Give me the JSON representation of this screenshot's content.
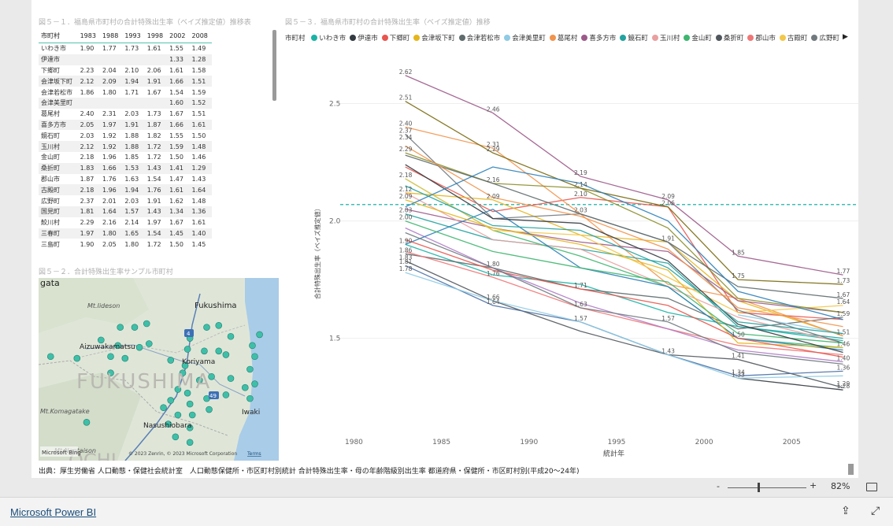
{
  "titles": {
    "table": "図５－１．福島県市町村の合計特殊出生率（ベイズ推定値）推移表",
    "map": "図５－２．合計特殊出生率サンプル市町村",
    "chart": "図５－３．福島県市町村の合計特殊出生率（ベイズ推定値）推移"
  },
  "table": {
    "headers": [
      "市町村",
      "1983",
      "1988",
      "1993",
      "1998",
      "2002",
      "2008"
    ],
    "rows": [
      [
        "いわき市",
        "1.90",
        "1.77",
        "1.73",
        "1.61",
        "1.55",
        "1.49"
      ],
      [
        "伊達市",
        "",
        "",
        "",
        "",
        "1.33",
        "1.28"
      ],
      [
        "下郷町",
        "2.23",
        "2.04",
        "2.10",
        "2.06",
        "1.61",
        "1.58"
      ],
      [
        "会津坂下町",
        "2.12",
        "2.09",
        "1.94",
        "1.91",
        "1.66",
        "1.51"
      ],
      [
        "会津若松市",
        "1.86",
        "1.80",
        "1.71",
        "1.67",
        "1.54",
        "1.59"
      ],
      [
        "会津美里町",
        "",
        "",
        "",
        "",
        "1.60",
        "1.52"
      ],
      [
        "葛尾村",
        "2.40",
        "2.31",
        "2.03",
        "1.73",
        "1.67",
        "1.51"
      ],
      [
        "喜多方市",
        "2.05",
        "1.97",
        "1.91",
        "1.87",
        "1.66",
        "1.61"
      ],
      [
        "鏡石町",
        "2.03",
        "1.92",
        "1.88",
        "1.82",
        "1.55",
        "1.50"
      ],
      [
        "玉川村",
        "2.12",
        "1.92",
        "1.88",
        "1.72",
        "1.59",
        "1.48"
      ],
      [
        "金山町",
        "2.18",
        "1.96",
        "1.85",
        "1.72",
        "1.50",
        "1.46"
      ],
      [
        "桑折町",
        "1.83",
        "1.66",
        "1.53",
        "1.43",
        "1.41",
        "1.29"
      ],
      [
        "郡山市",
        "1.87",
        "1.76",
        "1.63",
        "1.54",
        "1.47",
        "1.43"
      ],
      [
        "古殿町",
        "2.18",
        "1.96",
        "1.94",
        "1.76",
        "1.61",
        "1.64"
      ],
      [
        "広野町",
        "2.37",
        "2.01",
        "2.03",
        "1.91",
        "1.62",
        "1.48"
      ],
      [
        "国見町",
        "1.81",
        "1.64",
        "1.57",
        "1.43",
        "1.34",
        "1.36"
      ],
      [
        "鮫川村",
        "2.29",
        "2.16",
        "2.14",
        "1.97",
        "1.67",
        "1.61"
      ],
      [
        "三春町",
        "1.97",
        "1.80",
        "1.65",
        "1.54",
        "1.45",
        "1.40"
      ],
      [
        "三島町",
        "1.90",
        "2.05",
        "1.80",
        "1.72",
        "1.50",
        "1.45"
      ]
    ]
  },
  "map": {
    "labels": {
      "gata": "gata",
      "iideson": "Mt.Iideson",
      "fukushima_city": "Fukushima",
      "aizu": "Aizuwakamatsu",
      "koriyama": "Koriyama",
      "pref": "FUKUSHIMA",
      "komagatake": "Mt.Komagatake",
      "nasu": "Nasushiobara",
      "iwaki": "Iwaki",
      "nantaisan": "Mt.Nantaison",
      "ochi": "OCHI",
      "road1": "4",
      "road2": "49",
      "brand": "Microsoft Bing",
      "copyright": "© 2023 Zenrin, © 2023 Microsoft Corporation",
      "terms": "Terms"
    },
    "pin_color": "#3fbfa8",
    "pins": [
      [
        0.34,
        0.27
      ],
      [
        0.4,
        0.27
      ],
      [
        0.45,
        0.25
      ],
      [
        0.63,
        0.33
      ],
      [
        0.7,
        0.27
      ],
      [
        0.75,
        0.26
      ],
      [
        0.8,
        0.32
      ],
      [
        0.26,
        0.34
      ],
      [
        0.33,
        0.37
      ],
      [
        0.42,
        0.38
      ],
      [
        0.46,
        0.36
      ],
      [
        0.62,
        0.39
      ],
      [
        0.69,
        0.4
      ],
      [
        0.75,
        0.4
      ],
      [
        0.89,
        0.37
      ],
      [
        0.92,
        0.31
      ],
      [
        0.16,
        0.44
      ],
      [
        0.3,
        0.43
      ],
      [
        0.36,
        0.44
      ],
      [
        0.55,
        0.45
      ],
      [
        0.61,
        0.48
      ],
      [
        0.78,
        0.42
      ],
      [
        0.9,
        0.43
      ],
      [
        0.6,
        0.52
      ],
      [
        0.67,
        0.56
      ],
      [
        0.72,
        0.54
      ],
      [
        0.8,
        0.55
      ],
      [
        0.88,
        0.5
      ],
      [
        0.9,
        0.58
      ],
      [
        0.58,
        0.61
      ],
      [
        0.62,
        0.63
      ],
      [
        0.7,
        0.66
      ],
      [
        0.78,
        0.64
      ],
      [
        0.88,
        0.66
      ],
      [
        0.86,
        0.6
      ],
      [
        0.55,
        0.67
      ],
      [
        0.63,
        0.69
      ],
      [
        0.58,
        0.75
      ],
      [
        0.64,
        0.75
      ],
      [
        0.54,
        0.8
      ],
      [
        0.63,
        0.82
      ],
      [
        0.57,
        0.87
      ],
      [
        0.63,
        0.9
      ],
      [
        0.05,
        0.43
      ],
      [
        0.3,
        0.52
      ],
      [
        0.2,
        0.79
      ],
      [
        0.52,
        0.71
      ],
      [
        0.71,
        0.72
      ]
    ]
  },
  "chart": {
    "legend_title": "市町村",
    "legend": [
      {
        "name": "いわき市",
        "color": "#1ab3a6"
      },
      {
        "name": "伊達市",
        "color": "#333a40"
      },
      {
        "name": "下郷町",
        "color": "#e8564f"
      },
      {
        "name": "会津坂下町",
        "color": "#e5b61c"
      },
      {
        "name": "会津若松市",
        "color": "#5f6b6d"
      },
      {
        "name": "会津美里町",
        "color": "#8fcbe4"
      },
      {
        "name": "葛尾村",
        "color": "#f2934d"
      },
      {
        "name": "喜多方市",
        "color": "#9c5a8a"
      },
      {
        "name": "鏡石町",
        "color": "#22a3a0"
      },
      {
        "name": "玉川村",
        "color": "#e9a0a0"
      },
      {
        "name": "金山町",
        "color": "#3fb670"
      },
      {
        "name": "桑折町",
        "color": "#50575c"
      },
      {
        "name": "郡山市",
        "color": "#f07777"
      },
      {
        "name": "古殿町",
        "color": "#f2c84b"
      },
      {
        "name": "広野町",
        "color": "#707a7f"
      }
    ],
    "next_icon": "▶"
  },
  "chart_data": {
    "type": "line",
    "xlabel": "統計年",
    "ylabel": "合計特殊出生率（ベイズ推定値）",
    "xlim": [
      1980,
      2010
    ],
    "ylim": [
      1.18,
      2.74
    ],
    "xticks": [
      "1980",
      "1985",
      "1990",
      "1995",
      "2000",
      "2005",
      "2010"
    ],
    "yticks": [
      "1.5",
      "2.0",
      "2.5"
    ],
    "reference_line": 2.07,
    "x": [
      1983,
      1988,
      1993,
      1998,
      2002,
      2008
    ],
    "series": [
      {
        "name": "いわき市",
        "color": "#1ab3a6",
        "values": [
          1.9,
          1.77,
          1.73,
          1.61,
          1.55,
          1.49
        ]
      },
      {
        "name": "伊達市",
        "color": "#333a40",
        "values": [
          null,
          null,
          null,
          null,
          1.33,
          1.28
        ]
      },
      {
        "name": "下郷町",
        "color": "#e8564f",
        "values": [
          2.23,
          2.04,
          2.1,
          2.06,
          1.61,
          1.58
        ]
      },
      {
        "name": "会津坂下町",
        "color": "#e5b61c",
        "values": [
          2.12,
          2.09,
          1.94,
          1.91,
          1.66,
          1.51
        ]
      },
      {
        "name": "会津若松市",
        "color": "#5f6b6d",
        "values": [
          1.86,
          1.8,
          1.71,
          1.67,
          1.54,
          1.59
        ]
      },
      {
        "name": "会津美里町",
        "color": "#8fcbe4",
        "values": [
          null,
          null,
          null,
          null,
          1.6,
          1.52
        ]
      },
      {
        "name": "葛尾村",
        "color": "#f2934d",
        "values": [
          2.4,
          2.31,
          2.03,
          1.73,
          1.67,
          1.51
        ]
      },
      {
        "name": "喜多方市",
        "color": "#9c5a8a",
        "values": [
          2.05,
          1.97,
          1.91,
          1.87,
          1.66,
          1.61
        ]
      },
      {
        "name": "鏡石町",
        "color": "#22a3a0",
        "values": [
          2.03,
          1.92,
          1.88,
          1.82,
          1.55,
          1.5
        ]
      },
      {
        "name": "玉川村",
        "color": "#e9a0a0",
        "values": [
          2.12,
          1.92,
          1.88,
          1.72,
          1.59,
          1.48
        ]
      },
      {
        "name": "金山町",
        "color": "#3fb670",
        "values": [
          2.18,
          1.96,
          1.85,
          1.72,
          1.5,
          1.46
        ]
      },
      {
        "name": "桑折町",
        "color": "#50575c",
        "values": [
          1.83,
          1.66,
          1.53,
          1.43,
          1.41,
          1.29
        ]
      },
      {
        "name": "郡山市",
        "color": "#f07777",
        "values": [
          1.87,
          1.76,
          1.63,
          1.54,
          1.47,
          1.43
        ]
      },
      {
        "name": "古殿町",
        "color": "#f2c84b",
        "values": [
          2.18,
          1.96,
          1.94,
          1.76,
          1.61,
          1.64
        ]
      },
      {
        "name": "広野町",
        "color": "#707a7f",
        "values": [
          2.37,
          2.01,
          2.03,
          1.91,
          1.62,
          1.48
        ]
      },
      {
        "name": "国見町",
        "color": "#4a6fa5",
        "values": [
          1.81,
          1.64,
          1.57,
          1.43,
          1.34,
          1.36
        ]
      },
      {
        "name": "鮫川村",
        "color": "#8a8f2a",
        "values": [
          2.29,
          2.16,
          2.14,
          1.97,
          1.67,
          1.61
        ]
      },
      {
        "name": "三春町",
        "color": "#b07cc6",
        "values": [
          1.97,
          1.8,
          1.65,
          1.54,
          1.45,
          1.4
        ]
      },
      {
        "name": "三島町",
        "color": "#2c7fb8",
        "values": [
          1.9,
          2.05,
          1.8,
          1.72,
          1.5,
          1.45
        ]
      },
      {
        "name": "",
        "color": "#9c5a8a",
        "values": [
          2.62,
          2.46,
          2.19,
          2.09,
          1.85,
          1.77
        ]
      },
      {
        "name": "",
        "color": "#7a6a10",
        "values": [
          2.51,
          2.29,
          2.14,
          2.06,
          1.75,
          1.73
        ]
      },
      {
        "name": "",
        "color": "#5f6b6d",
        "values": [
          2.28,
          2.16,
          2.03,
          1.91,
          1.72,
          1.67
        ]
      },
      {
        "name": "",
        "color": "#8fcbe4",
        "values": [
          1.78,
          1.66,
          1.57,
          1.43,
          1.33,
          1.34
        ]
      },
      {
        "name": "",
        "color": "#e5b61c",
        "values": [
          2.09,
          1.97,
          1.9,
          1.79,
          1.48,
          1.46
        ]
      },
      {
        "name": "",
        "color": "#3fb670",
        "values": [
          2.0,
          1.87,
          1.8,
          1.74,
          1.52,
          1.48
        ]
      },
      {
        "name": "",
        "color": "#333a40",
        "values": [
          2.24,
          2.01,
          1.99,
          1.83,
          1.56,
          1.44
        ]
      },
      {
        "name": "",
        "color": "#e8564f",
        "values": [
          1.92,
          1.79,
          1.71,
          1.64,
          1.5,
          1.42
        ]
      },
      {
        "name": "",
        "color": "#22a3a0",
        "values": [
          2.15,
          1.98,
          1.96,
          1.8,
          1.57,
          1.52
        ]
      },
      {
        "name": "",
        "color": "#f2934d",
        "values": [
          2.32,
          2.1,
          2.02,
          1.88,
          1.63,
          1.55
        ]
      },
      {
        "name": "",
        "color": "#2c7fb8",
        "values": [
          2.06,
          2.23,
          2.16,
          2.0,
          1.7,
          1.58
        ]
      },
      {
        "name": "",
        "color": "#707a7f",
        "values": [
          1.95,
          1.8,
          1.63,
          1.57,
          1.44,
          1.39
        ]
      }
    ],
    "point_labels": [
      [
        "2.62",
        1983,
        2.62
      ],
      [
        "2.51",
        1983,
        2.51
      ],
      [
        "2.40",
        1983,
        2.4
      ],
      [
        "2.37",
        1983,
        2.37
      ],
      [
        "2.34",
        1983,
        2.34
      ],
      [
        "2.29",
        1983,
        2.29
      ],
      [
        "2.18",
        1983,
        2.18
      ],
      [
        "2.12",
        1983,
        2.12
      ],
      [
        "2.09",
        1983,
        2.09
      ],
      [
        "2.03",
        1983,
        2.03
      ],
      [
        "2.00",
        1983,
        2.0
      ],
      [
        "1.90",
        1983,
        1.9
      ],
      [
        "1.86",
        1983,
        1.86
      ],
      [
        "1.83",
        1983,
        1.83
      ],
      [
        "1.81",
        1983,
        1.81
      ],
      [
        "1.78",
        1983,
        1.78
      ],
      [
        "2.46",
        1988,
        2.46
      ],
      [
        "2.31",
        1988,
        2.31
      ],
      [
        "2.29",
        1988,
        2.29
      ],
      [
        "2.16",
        1988,
        2.16
      ],
      [
        "2.09",
        1988,
        2.09
      ],
      [
        "1.80",
        1988,
        1.8
      ],
      [
        "1.76",
        1988,
        1.76
      ],
      [
        "1.66",
        1988,
        1.66
      ],
      [
        "1.64",
        1988,
        1.64
      ],
      [
        "2.19",
        1993,
        2.19
      ],
      [
        "2.14",
        1993,
        2.14
      ],
      [
        "2.10",
        1993,
        2.1
      ],
      [
        "2.03",
        1993,
        2.03
      ],
      [
        "1.71",
        1993,
        1.71
      ],
      [
        "1.63",
        1993,
        1.63
      ],
      [
        "1.57",
        1993,
        1.57
      ],
      [
        "2.09",
        1998,
        2.09
      ],
      [
        "2.06",
        1998,
        2.06
      ],
      [
        "1.91",
        1998,
        1.91
      ],
      [
        "1.57",
        1998,
        1.57
      ],
      [
        "1.43",
        1998,
        1.43
      ],
      [
        "1.85",
        2002,
        1.85
      ],
      [
        "1.75",
        2002,
        1.75
      ],
      [
        "1.50",
        2002,
        1.5
      ],
      [
        "1.41",
        2002,
        1.41
      ],
      [
        "1.33",
        2002,
        1.33
      ],
      [
        "1.34",
        2002,
        1.34
      ],
      [
        "1.77",
        2008,
        1.77
      ],
      [
        "1.73",
        2008,
        1.73
      ],
      [
        "1.67",
        2008,
        1.67
      ],
      [
        "1.64",
        2008,
        1.64
      ],
      [
        "1.59",
        2008,
        1.59
      ],
      [
        "1.51",
        2008,
        1.51
      ],
      [
        "1.46",
        2008,
        1.46
      ],
      [
        "1.40",
        2008,
        1.4
      ],
      [
        "1.36",
        2008,
        1.36
      ],
      [
        "1.29",
        2008,
        1.29
      ],
      [
        "1.28",
        2008,
        1.28
      ]
    ]
  },
  "footnote": "出典：厚生労働省 人口動態・保健社会統計室　人口動態保健所・市区町村別統計 合計特殊出生率・母の年齢階級別出生率 都道府県・保健所・市区町村別(平成20～24年)",
  "status": {
    "zoom_minus": "-",
    "zoom_plus": "+",
    "zoom_level": "82%",
    "zoom_fraction": 0.38
  },
  "bottom": {
    "link": "Microsoft Power BI",
    "share_icon": "⇪",
    "expand_icon": "⤢"
  }
}
